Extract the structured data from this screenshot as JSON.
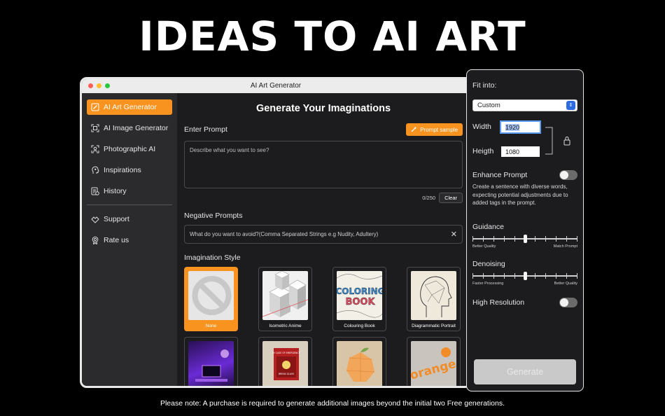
{
  "headline": "IDEAS TO AI ART",
  "window": {
    "title": "AI Art Generator"
  },
  "sidebar": {
    "items": [
      {
        "label": "AI Art Generator",
        "icon": "image-edit-icon",
        "active": true
      },
      {
        "label": "AI Image Generator",
        "icon": "image-scan-icon"
      },
      {
        "label": "Photographic AI",
        "icon": "portrait-scan-icon"
      },
      {
        "label": "Inspirations",
        "icon": "head-idea-icon"
      },
      {
        "label": "History",
        "icon": "history-list-icon"
      }
    ],
    "bottom_items": [
      {
        "label": "Support",
        "icon": "support-icon"
      },
      {
        "label": "Rate us",
        "icon": "rate-badge-icon"
      }
    ]
  },
  "main": {
    "title": "Generate Your Imaginations",
    "prompt_label": "Enter Prompt",
    "prompt_sample_label": "Prompt sample",
    "prompt_placeholder": "Describe what you want to see?",
    "counter": "0/250",
    "clear_label": "Clear",
    "negative_label": "Negative Prompts",
    "negative_placeholder": "What do you want to avoid?(Comma Separated Strings e.g Nudity, Adultery)",
    "style_label": "Imagination Style",
    "styles": [
      {
        "caption": "None",
        "selected": true
      },
      {
        "caption": "Isometric Anime"
      },
      {
        "caption": "Colouring Book"
      },
      {
        "caption": "Diagrammatic Portrait"
      },
      {
        "caption": ""
      },
      {
        "caption": ""
      },
      {
        "caption": ""
      },
      {
        "caption": ""
      }
    ],
    "coloring_book_art_text": "COLORING BOOK",
    "in_case_sign_text": "IN CASE OF EMERGENCY BREAK GLASS",
    "orange_art_text": "orange"
  },
  "panel": {
    "fit_label": "Fit into:",
    "fit_value": "Custom",
    "width_label": "Width",
    "width_value": "1920",
    "height_label": "Heigth",
    "height_value": "1080",
    "enhance_label": "Enhance Prompt",
    "enhance_desc": "Create a sentence with diverse words, expecting potential adjustments due to added tags in the prompt.",
    "enhance_on": false,
    "guidance_label": "Guidance",
    "guidance_min": "Better Quality",
    "guidance_max": "Match Prompt",
    "guidance_level": 0.5,
    "denoising_label": "Denoising",
    "denoising_min": "Faster Processing",
    "denoising_max": "Better Quality",
    "denoising_level": 0.5,
    "highres_label": "High Resolution",
    "highres_on": false,
    "generate_label": "Generate"
  },
  "footer": "Please note: A purchase is required to generate additional images beyond the initial two Free generations.",
  "colors": {
    "accent": "#f7931e",
    "background": "#000000",
    "panel": "#1c1c1e",
    "sidebar": "#2b2b2d"
  }
}
